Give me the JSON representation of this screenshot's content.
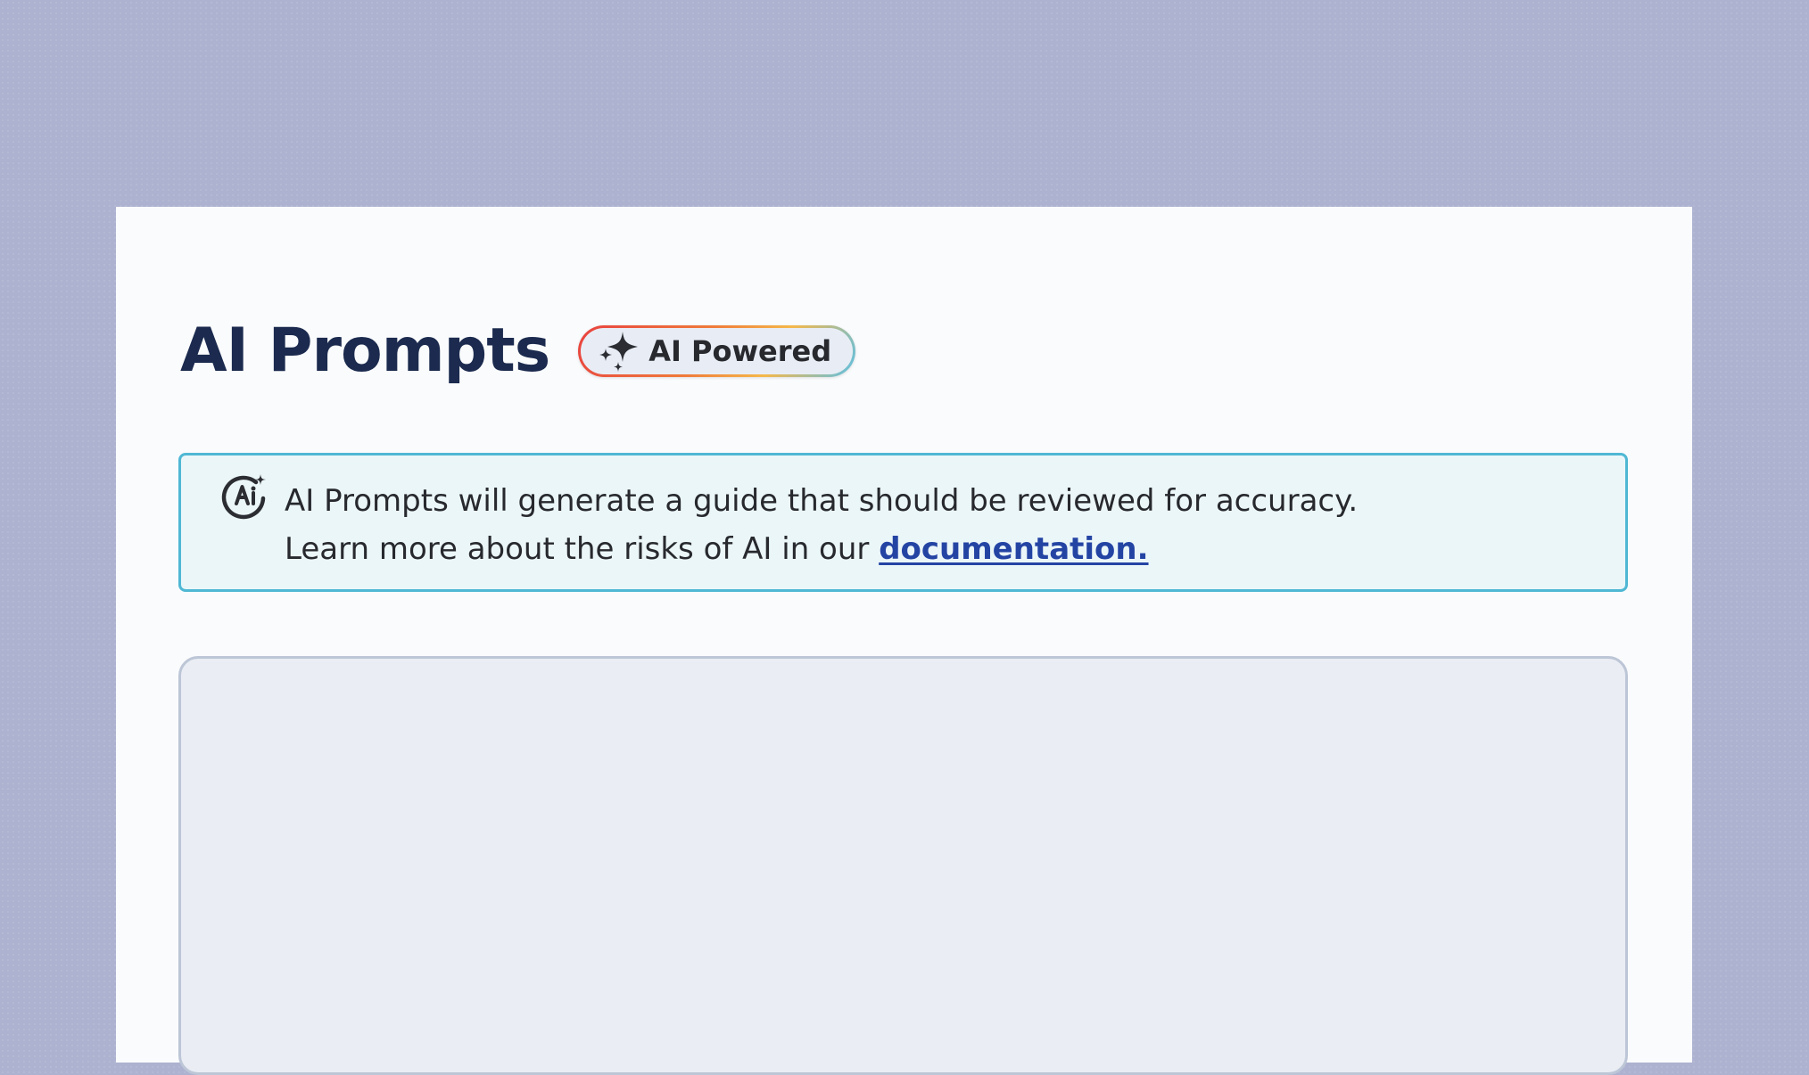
{
  "page": {
    "title": "AI Prompts",
    "badge": {
      "label": "AI Powered",
      "icon": "sparkles-icon"
    }
  },
  "notice": {
    "icon": "ai-sparkle-icon",
    "line1": "AI Prompts will generate a guide that should be reviewed for accuracy.",
    "line2_prefix": "Learn more about the risks of AI in our ",
    "link_label": "documentation."
  },
  "prompt_area": {
    "value": ""
  },
  "colors": {
    "background": "#adb2d0",
    "panel": "#fafbfd",
    "title": "#1b2a4e",
    "notice_border": "#4fb8d4",
    "notice_bg": "#ebf6f9",
    "link": "#2444a4",
    "prompt_bg": "#eaedf4",
    "prompt_border": "#bcc6d6"
  }
}
